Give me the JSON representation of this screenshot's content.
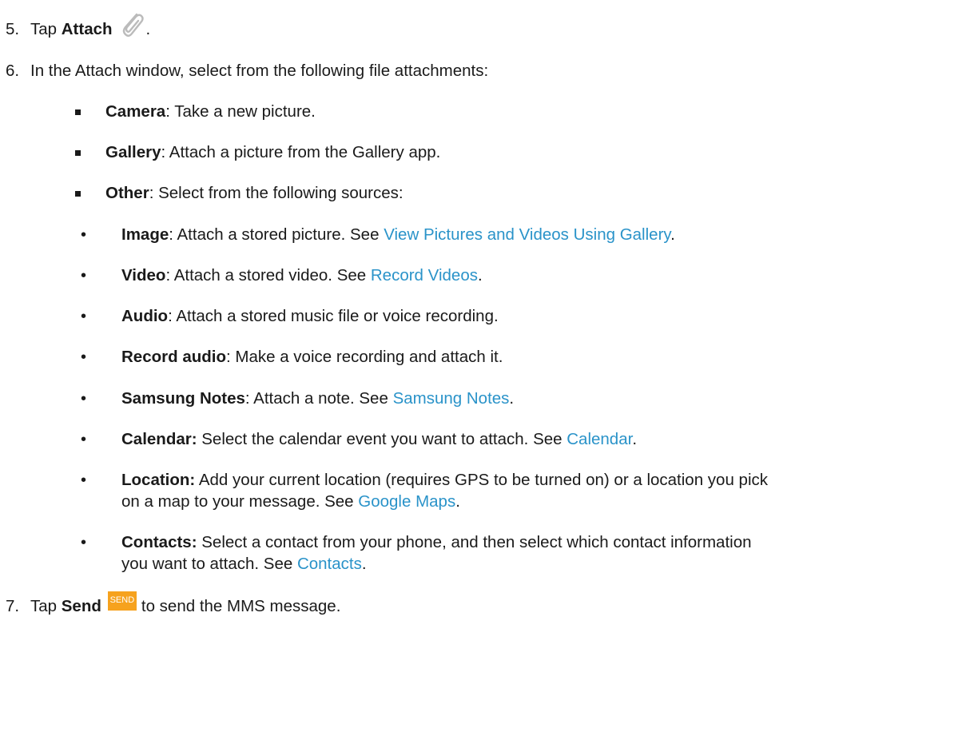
{
  "steps": {
    "step5": {
      "num": "5.",
      "pre": "Tap ",
      "bold": "Attach",
      "post": "."
    },
    "step6": {
      "num": "6.",
      "text": "In the Attach window, select from the following file attachments:"
    },
    "step7": {
      "num": "7.",
      "pre": "Tap ",
      "bold": "Send",
      "badge": "SEND",
      "post": "to send the MMS message."
    }
  },
  "options": [
    {
      "bold": "Camera",
      "text": ": Take a new picture."
    },
    {
      "bold": "Gallery",
      "text": ": Attach a picture from the Gallery app."
    },
    {
      "bold": "Other",
      "text": ": Select from the following sources:"
    }
  ],
  "sources": [
    {
      "bold": "Image",
      "text": ": Attach a stored picture. See ",
      "link": "View Pictures and Videos Using Gallery",
      "end": "."
    },
    {
      "bold": "Video",
      "text": ": Attach a stored video. See ",
      "link": "Record Videos",
      "end": "."
    },
    {
      "bold": "Audio",
      "text": ": Attach a stored music file or voice recording."
    },
    {
      "bold": "Record audio",
      "text": ": Make a voice recording and attach it."
    },
    {
      "bold": "Samsung Notes",
      "text": ": Attach a note. See ",
      "link": "Samsung Notes",
      "end": "."
    },
    {
      "bold": "Calendar:",
      "text": " Select the calendar event you want to attach. See ",
      "link": "Calendar",
      "end": "."
    },
    {
      "bold": "Location:",
      "text": " Add your current location (requires GPS to be turned on) or a location you pick",
      "text2": "on a map to your message. See ",
      "link": "Google Maps",
      "end": "."
    },
    {
      "bold": "Contacts:",
      "text": " Select a contact from your phone, and then select which contact information",
      "text2": "you want to attach. See ",
      "link": "Contacts",
      "end": "."
    }
  ],
  "icons": {
    "attach": "paperclip-icon",
    "send": "send-badge"
  },
  "colors": {
    "link": "#2a93c9",
    "send_badge": "#f6a21e"
  }
}
